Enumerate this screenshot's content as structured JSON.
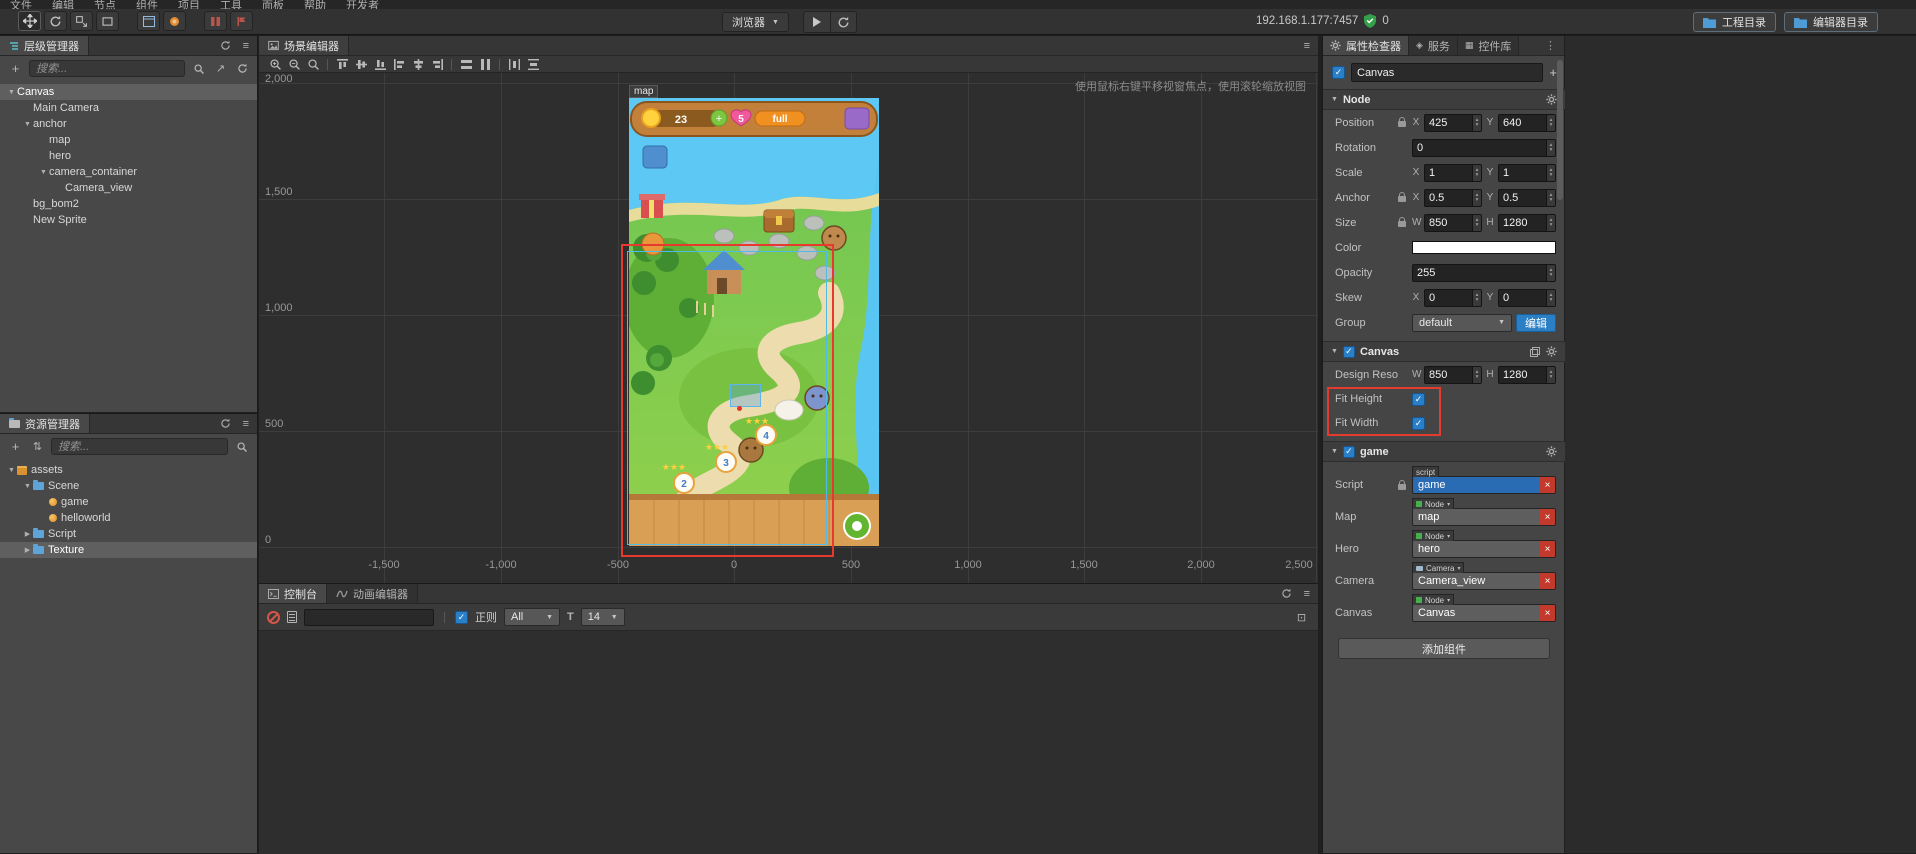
{
  "menubar": {
    "items": [
      "文件",
      "编辑",
      "节点",
      "组件",
      "项目",
      "工具",
      "面板",
      "帮助",
      "开发者"
    ]
  },
  "toolbar": {
    "browser": "浏览器",
    "ip": "192.168.1.177:7457",
    "shield_count": "0",
    "project_dir": "工程目录",
    "editor_dir": "编辑器目录"
  },
  "hierarchy": {
    "title": "层级管理器",
    "search_placeholder": "搜索...",
    "nodes": [
      {
        "arrow": "▼",
        "label": "Canvas"
      },
      {
        "arrow": "",
        "label": "Main Camera"
      },
      {
        "arrow": "▼",
        "label": "anchor"
      },
      {
        "arrow": "",
        "label": "map"
      },
      {
        "arrow": "",
        "label": "hero"
      },
      {
        "arrow": "▼",
        "label": "camera_container"
      },
      {
        "arrow": "",
        "label": "Camera_view"
      },
      {
        "arrow": "",
        "label": "bg_bom2"
      },
      {
        "arrow": "",
        "label": "New Sprite"
      }
    ]
  },
  "assets": {
    "title": "资源管理器",
    "search_placeholder": "搜索...",
    "nodes": [
      {
        "arrow": "▼",
        "label": "assets"
      },
      {
        "arrow": "▼",
        "label": "Scene"
      },
      {
        "arrow": "",
        "label": "game"
      },
      {
        "arrow": "",
        "label": "helloworld"
      },
      {
        "arrow": "▶",
        "label": "Script"
      },
      {
        "arrow": "▶",
        "label": "Texture"
      }
    ]
  },
  "scene": {
    "title": "场景编辑器",
    "hint": "使用鼠标右键平移视窗焦点，使用滚轮缩放视图",
    "object_label": "map",
    "y_labels": [
      "2,000",
      "1,500",
      "1,000",
      "500",
      "0"
    ],
    "x_labels": [
      "-1,500",
      "-1,000",
      "-500",
      "0",
      "500",
      "1,000",
      "1,500",
      "2,000",
      "2,500"
    ]
  },
  "game": {
    "coin": "23",
    "plus": "+",
    "lives": "5",
    "full": "full",
    "levels": [
      "2",
      "3",
      "4"
    ]
  },
  "console": {
    "tab": "控制台",
    "anim_tab": "动画编辑器",
    "regex": "正则",
    "filter": "All",
    "font_icon": "T",
    "font_size": "14"
  },
  "inspector": {
    "tab": "属性检查器",
    "tab_service": "服务",
    "tab_widget": "控件库",
    "name": "Canvas",
    "node": {
      "title": "Node",
      "position": {
        "label": "Position",
        "k1": "X",
        "v1": "425",
        "k2": "Y",
        "v2": "640"
      },
      "rotation": {
        "label": "Rotation",
        "v": "0"
      },
      "scale": {
        "label": "Scale",
        "k1": "X",
        "v1": "1",
        "k2": "Y",
        "v2": "1"
      },
      "anchor": {
        "label": "Anchor",
        "k1": "X",
        "v1": "0.5",
        "k2": "Y",
        "v2": "0.5"
      },
      "size": {
        "label": "Size",
        "k1": "W",
        "v1": "850",
        "k2": "H",
        "v2": "1280"
      },
      "color_label": "Color",
      "opacity": {
        "label": "Opacity",
        "v": "255"
      },
      "skew": {
        "label": "Skew",
        "k1": "X",
        "v1": "0",
        "k2": "Y",
        "v2": "0"
      },
      "group": {
        "label": "Group",
        "value": "default",
        "edit": "编辑"
      }
    },
    "canvas": {
      "title": "Canvas",
      "design": {
        "label": "Design Reso...",
        "k1": "W",
        "v1": "850",
        "k2": "H",
        "v2": "1280"
      },
      "fit_height": "Fit Height",
      "fit_width": "Fit Width"
    },
    "game": {
      "title": "game",
      "script": {
        "label": "Script",
        "tag": "script",
        "value": "game"
      },
      "map": {
        "label": "Map",
        "tag": "Node",
        "value": "map"
      },
      "hero": {
        "label": "Hero",
        "tag": "Node",
        "value": "hero"
      },
      "camera": {
        "label": "Camera",
        "tag": "Camera",
        "value": "Camera_view"
      },
      "canvas": {
        "label": "Canvas",
        "tag": "Node",
        "value": "Canvas"
      }
    },
    "add_component": "添加组件"
  }
}
